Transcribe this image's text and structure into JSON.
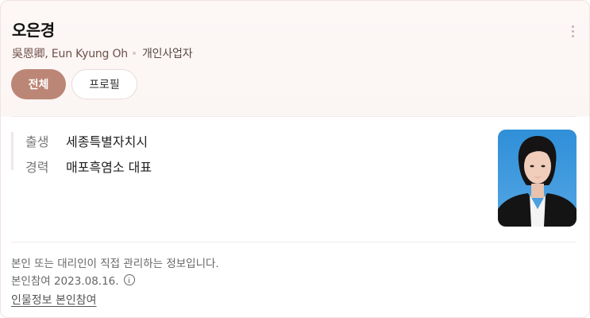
{
  "profile": {
    "name": "오은경",
    "hanja_en": "吳恩卿, Eun Kyung Oh",
    "job": "개인사업자"
  },
  "tabs": [
    {
      "label": "전체",
      "active": true
    },
    {
      "label": "프로필",
      "active": false
    }
  ],
  "info": [
    {
      "key": "출생",
      "value": "세종특별자치시"
    },
    {
      "key": "경력",
      "value": "매포흑염소 대표"
    }
  ],
  "footer": {
    "note": "본인 또는 대리인이 직접 관리하는 정보입니다.",
    "date": "본인참여 2023.08.16.",
    "link": "인물정보 본인참여"
  },
  "colors": {
    "accent": "#bc8676",
    "subtitle": "#6d4f48"
  },
  "icons": {
    "more": "more-vertical-icon",
    "info": "info-circle-icon"
  }
}
